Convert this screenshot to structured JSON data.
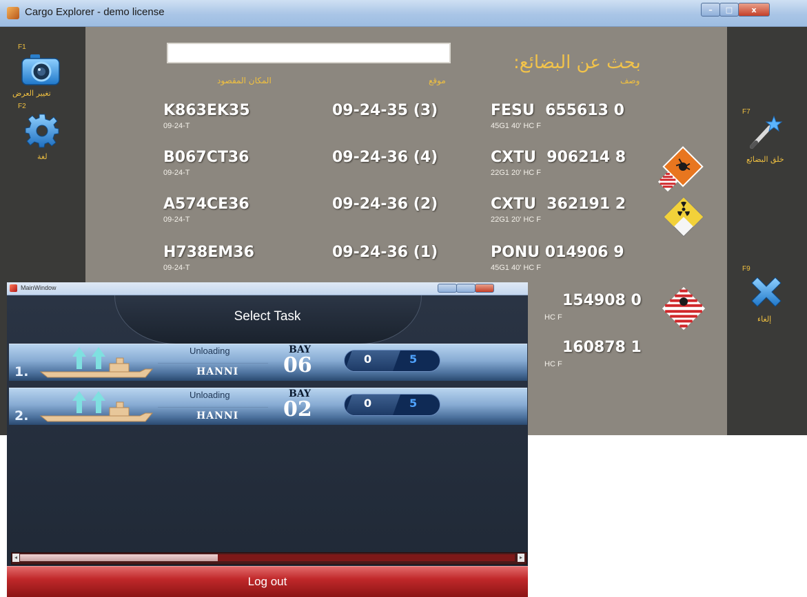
{
  "cargo_window": {
    "title": "Cargo Explorer - demo license",
    "caption": {
      "minimize": "–",
      "maximize": "□",
      "close": "x"
    },
    "left_bar": {
      "f1": "F1",
      "f1_label": "تغيير العرض",
      "f2": "F2",
      "f2_label": "لغة"
    },
    "right_bar": {
      "f7": "F7",
      "f7_label": "خلق البضائع",
      "f9": "F9",
      "f9_label": "إلغاء"
    },
    "search": {
      "value": "",
      "label": "بحث عن البضائع:"
    },
    "columns": {
      "destination": "المكان المقصود",
      "position": "موقع",
      "description": "وصف"
    },
    "rows": [
      {
        "dest": "K863EK35",
        "dest_sub": "09-24-T",
        "pos": "09-24-35 (3)",
        "cont": "FESU  655613 0",
        "cont_sub": "45G1 40' HC F",
        "hazard": ""
      },
      {
        "dest": "B067CT36",
        "dest_sub": "09-24-T",
        "pos": "09-24-36 (4)",
        "cont": "CXTU  906214 8",
        "cont_sub": "22G1 20' HC F",
        "hazard": "explosive"
      },
      {
        "dest": "A574CE36",
        "dest_sub": "09-24-T",
        "pos": "09-24-36 (2)",
        "cont": "CXTU  362191 2",
        "cont_sub": "22G1 20' HC F",
        "hazard": "radioactive"
      },
      {
        "dest": "H738EM36",
        "dest_sub": "09-24-T",
        "pos": "09-24-36 (1)",
        "cont": "PONU 014906 9",
        "cont_sub": "45G1 40' HC F",
        "hazard": ""
      },
      {
        "dest": "",
        "dest_sub": "",
        "pos": "",
        "cont": "154908 0",
        "cont_sub": "HC F",
        "hazard": "flammable-solid"
      },
      {
        "dest": "",
        "dest_sub": "",
        "pos": "",
        "cont": "160878 1",
        "cont_sub": "HC F",
        "hazard": ""
      }
    ]
  },
  "main_window": {
    "title": "MainWindow",
    "header": "Select Task",
    "tasks": [
      {
        "number": "1.",
        "type": "Unloading",
        "vessel": "HANNI",
        "bay_label": "BAY",
        "bay": "06",
        "done": "0",
        "total": "5"
      },
      {
        "number": "2.",
        "type": "Unloading",
        "vessel": "HANNI",
        "bay_label": "BAY",
        "bay": "02",
        "done": "0",
        "total": "5"
      }
    ],
    "scrollbar": {
      "position": 0.4
    },
    "logout_label": "Log out"
  }
}
